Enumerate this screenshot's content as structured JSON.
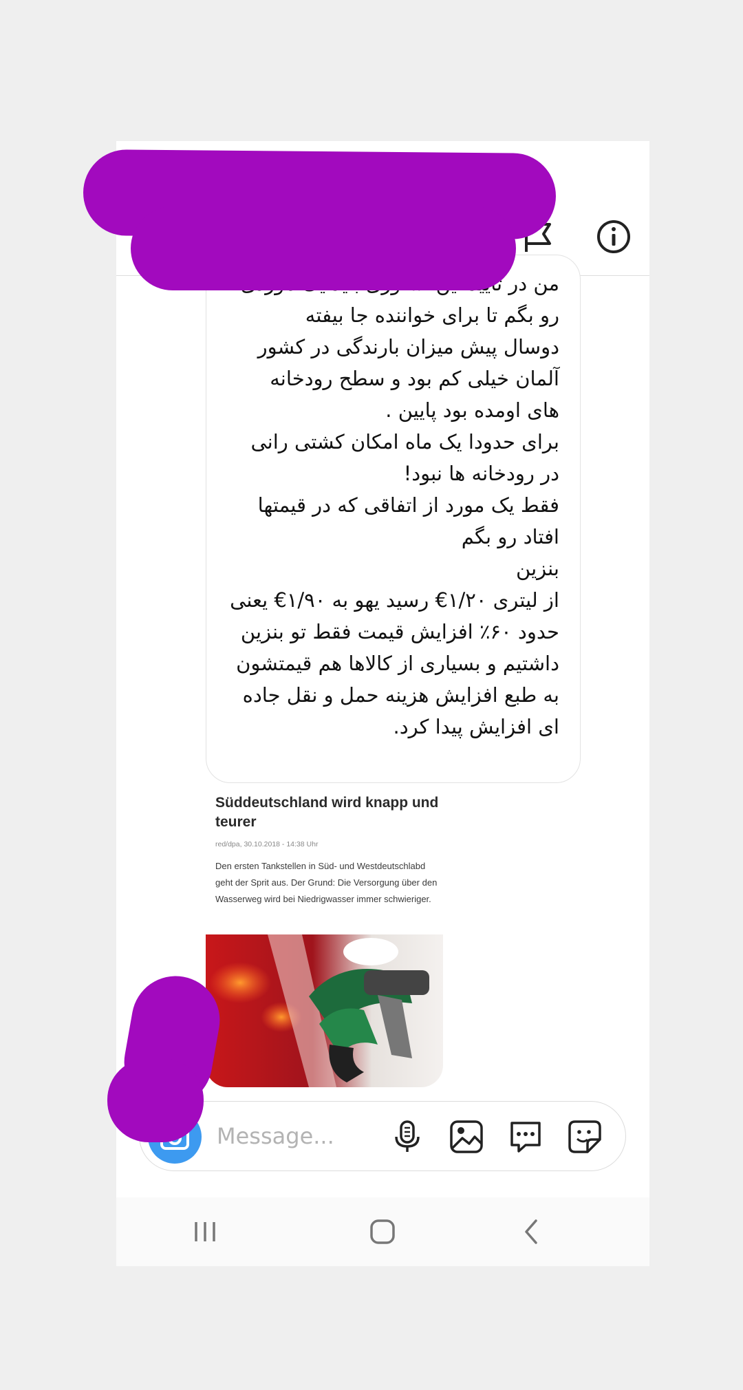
{
  "message": {
    "lines": [
      "من در تایید این استوری باید یک موردی",
      "رو بگم تا برای خواننده جا بیفته",
      "دوسال پیش میزان بارندگی در کشور",
      "آلمان خیلی کم بود و سطح رودخانه",
      "های اومده بود پایین .",
      "برای حدودا یک ماه امکان کشتی رانی",
      "در رودخانه ها نبود!",
      "فقط یک مورد از اتفاقی که در قیمتها",
      "افتاد رو بگم",
      "بنزین",
      "از لیتری ۱/۲۰€ رسید یهو به ۱/۹۰€ یعنی",
      "حدود ۶۰٪ افزایش قیمت فقط تو بنزین",
      "داشتیم و بسیاری از کالاها هم قیمتشون",
      "به طبع افزایش هزینه حمل و نقل جاده",
      "ای افزایش پیدا کرد."
    ]
  },
  "article": {
    "headline": "Süddeutschland wird knapp und teurer",
    "byline": "red/dpa, 30.10.2018 - 14:38 Uhr",
    "body": "Den ersten Tankstellen in Süd- und Westdeutschlabd geht der Sprit aus. Der Grund: Die Versorgung über den Wasserweg wird bei Niedrigwasser immer schwieriger."
  },
  "composer": {
    "placeholder": "Message..."
  },
  "icons": {
    "header": [
      "flag-icon",
      "info-icon"
    ],
    "composer": [
      "camera-icon",
      "microphone-icon",
      "image-icon",
      "chat-icon",
      "sticker-icon"
    ],
    "navbar": [
      "recent-apps-icon",
      "home-icon",
      "back-icon"
    ]
  },
  "colors": {
    "accent": "#3d9af0",
    "redaction": "#a20abe",
    "background": "#efefef"
  }
}
